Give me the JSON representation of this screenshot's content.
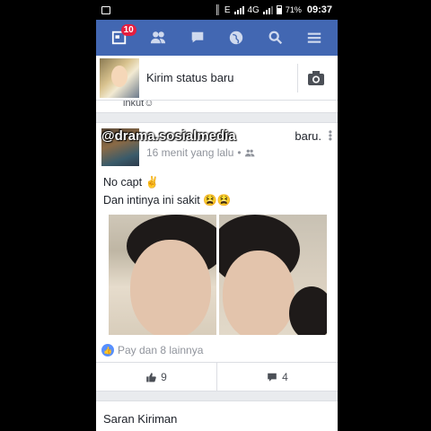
{
  "status_bar": {
    "network": "E",
    "network2": "4G",
    "battery": "71%",
    "time": "09:37"
  },
  "nav": {
    "notifications_badge": "10",
    "icons": [
      "home-icon",
      "friends-icon",
      "messages-icon",
      "globe-icon",
      "search-icon",
      "menu-icon"
    ]
  },
  "composer": {
    "placeholder": "Kirim status baru"
  },
  "previous_post": {
    "partial_text": "inkut☺"
  },
  "post": {
    "watermark": "@drama.sosialmedia",
    "name_suffix": "baru.",
    "time": "16 menit yang lalu",
    "line1": "No capt ✌",
    "line2": "Dan intinya ini sakit 😫😫",
    "reactions": "Pay dan 8 lainnya",
    "likes": "9",
    "comments": "4"
  },
  "suggestions": {
    "title": "Saran Kiriman"
  },
  "colors": {
    "brand": "#4267b2",
    "badge": "#e41e3f",
    "like": "#5890ff"
  }
}
